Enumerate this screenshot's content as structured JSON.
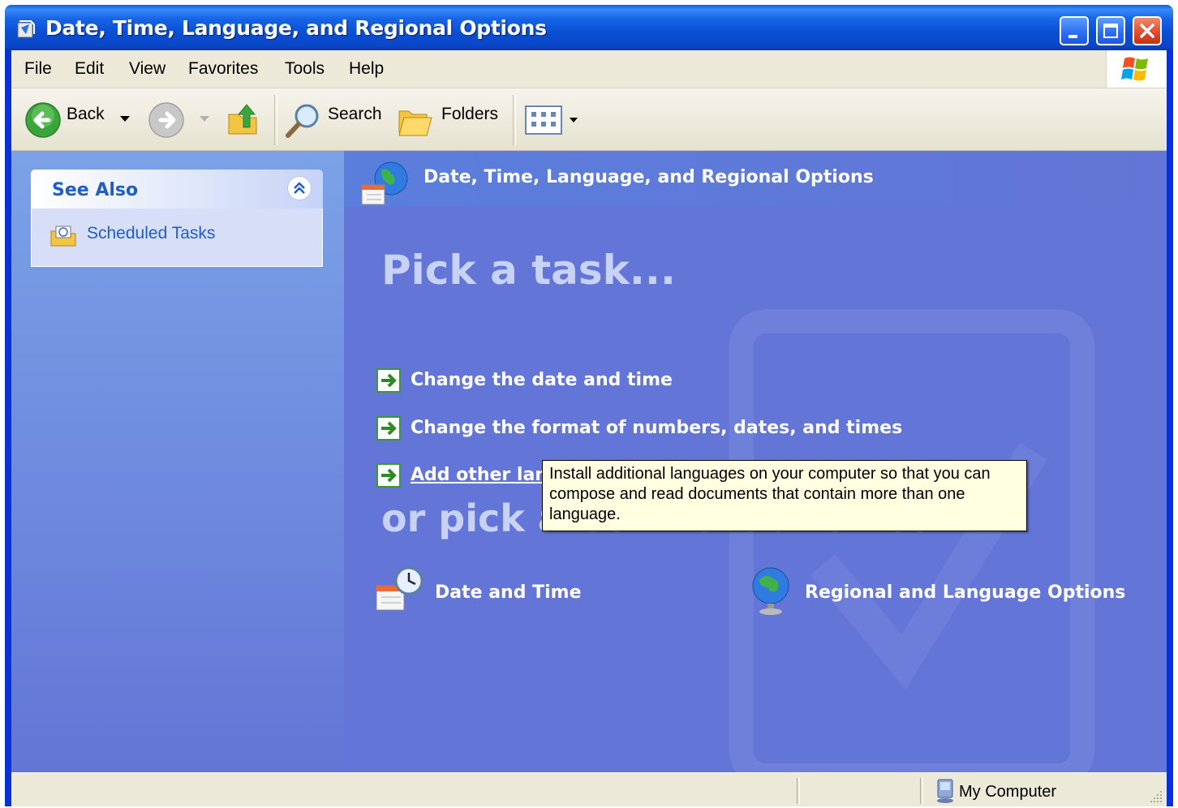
{
  "window": {
    "title": "Date, Time, Language, and Regional Options"
  },
  "menubar": {
    "items": [
      "File",
      "Edit",
      "View",
      "Favorites",
      "Tools",
      "Help"
    ]
  },
  "toolbar": {
    "back_label": "Back",
    "search_label": "Search",
    "folders_label": "Folders"
  },
  "see_also": {
    "title": "See Also",
    "links": [
      "Scheduled Tasks"
    ]
  },
  "main": {
    "header_title": "Date, Time, Language, and Regional Options",
    "pick_task_heading": "Pick a task...",
    "tasks": [
      "Change the date and time",
      "Change the format of numbers, dates, and times",
      "Add other languages"
    ],
    "or_pick_heading": "or pick a Control Panel icon",
    "icons": [
      "Date and Time",
      "Regional and Language Options"
    ]
  },
  "tooltip": {
    "text": "Install additional languages on your computer so that you can compose and read documents that contain more than one language."
  },
  "statusbar": {
    "location": "My Computer"
  },
  "colors": {
    "titlebar_blue": "#0a4fd4",
    "content_blue": "#6375d6",
    "link_blue": "#215dc6",
    "arrow_green": "#3a9a2f",
    "tooltip_bg": "#ffffe1"
  },
  "icons": [
    "back-arrow-icon",
    "forward-arrow-icon",
    "up-folder-icon",
    "search-icon",
    "folders-icon",
    "views-icon",
    "windows-logo-icon",
    "scheduled-tasks-icon",
    "globe-calendar-icon",
    "green-arrow-icon",
    "date-time-icon",
    "regional-globe-icon",
    "computer-icon"
  ]
}
